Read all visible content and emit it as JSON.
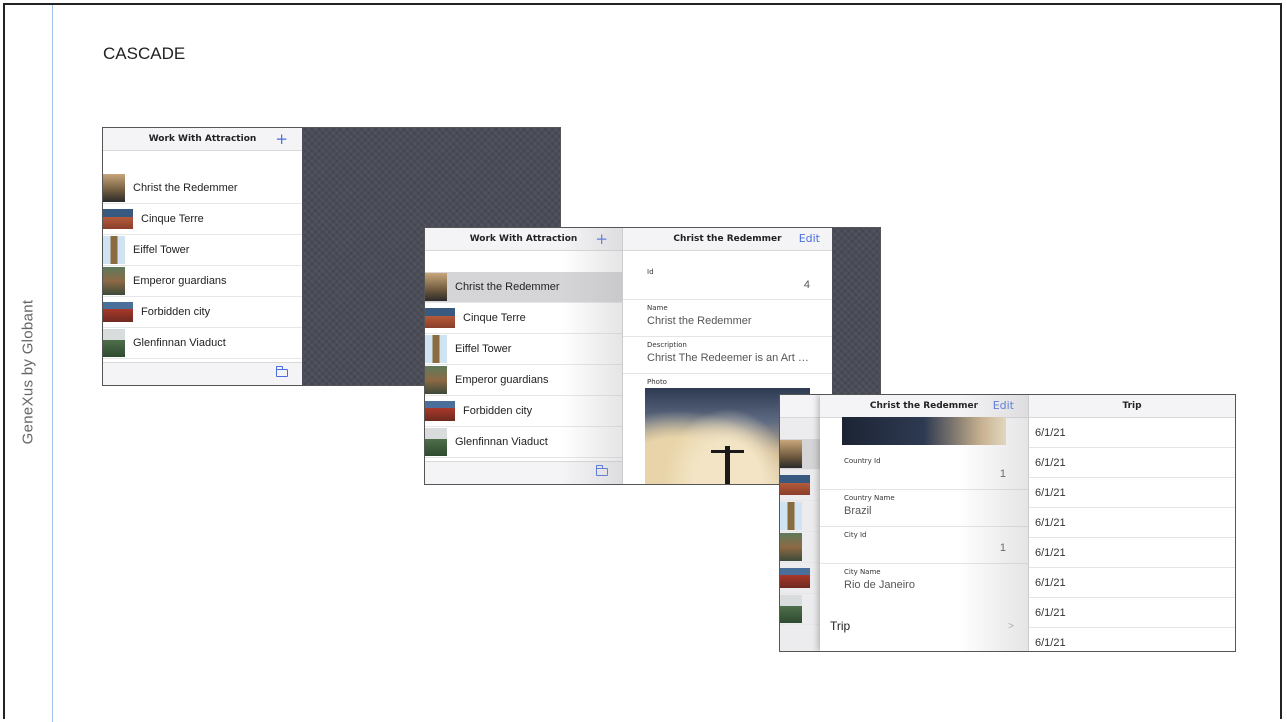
{
  "slide": {
    "title": "CASCADE",
    "side_label": "GeneXus by Globant"
  },
  "list": {
    "title": "Work With Attraction",
    "add_icon": "+",
    "items": [
      {
        "label": "Christ the Redemmer"
      },
      {
        "label": "Cinque Terre"
      },
      {
        "label": "Eiffel Tower"
      },
      {
        "label": "Emperor guardians"
      },
      {
        "label": "Forbidden city"
      },
      {
        "label": "Glenfinnan Viaduct"
      }
    ]
  },
  "detail": {
    "title": "Christ the Redemmer",
    "edit_label": "Edit",
    "fields": {
      "id_label": "Id",
      "id_value": "4",
      "name_label": "Name",
      "name_value": "Christ the Redemmer",
      "description_label": "Description",
      "description_value": "Christ The Redeemer is an Art De…",
      "photo_label": "Photo"
    }
  },
  "city_detail": {
    "title": "Christ the Redemmer",
    "edit_label": "Edit",
    "country_id_label": "Country Id",
    "country_id_value": "1",
    "country_name_label": "Country Name",
    "country_name_value": "Brazil",
    "city_id_label": "City Id",
    "city_id_value": "1",
    "city_name_label": "City Name",
    "city_name_value": "Rio de Janeiro",
    "trip_link_label": "Trip",
    "chevron": ">"
  },
  "trip": {
    "title": "Trip",
    "dates": [
      "6/1/21",
      "6/1/21",
      "6/1/21",
      "6/1/21",
      "6/1/21",
      "6/1/21",
      "6/1/21",
      "6/1/21"
    ]
  },
  "colors": {
    "accent": "#4a6ee0",
    "backdrop": "#4a4c57"
  },
  "icons": {
    "add": "plus-icon",
    "folder": "folder-icon",
    "chevron": "chevron-right-icon"
  }
}
